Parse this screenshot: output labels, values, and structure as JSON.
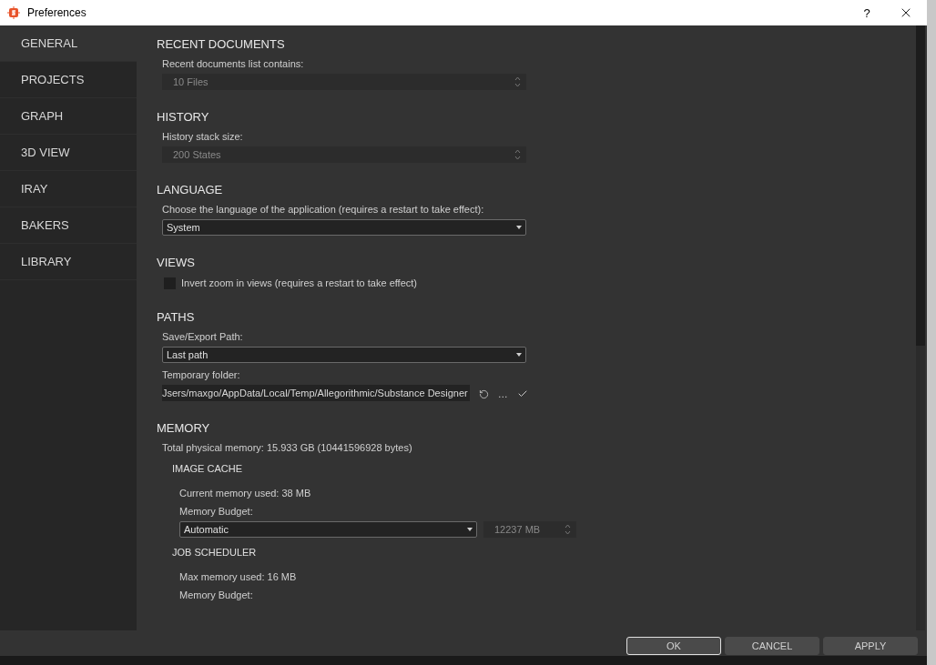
{
  "window": {
    "title": "Preferences",
    "help": "?"
  },
  "sidebar": {
    "items": [
      {
        "label": "GENERAL",
        "selected": true
      },
      {
        "label": "PROJECTS",
        "selected": false
      },
      {
        "label": "GRAPH",
        "selected": false
      },
      {
        "label": "3D VIEW",
        "selected": false
      },
      {
        "label": "IRAY",
        "selected": false
      },
      {
        "label": "BAKERS",
        "selected": false
      },
      {
        "label": "LIBRARY",
        "selected": false
      }
    ]
  },
  "sections": [
    {
      "title": "RECENT DOCUMENTS",
      "rows": [
        {
          "kind": "label",
          "text": "Recent documents list contains:"
        },
        {
          "kind": "spin",
          "value": "10 Files",
          "disabled": true
        }
      ]
    },
    {
      "title": "HISTORY",
      "rows": [
        {
          "kind": "label",
          "text": "History stack size:"
        },
        {
          "kind": "spin",
          "value": "200 States",
          "disabled": true
        }
      ]
    },
    {
      "title": "LANGUAGE",
      "rows": [
        {
          "kind": "label",
          "text": "Choose the language of the application (requires a restart to take effect):"
        },
        {
          "kind": "select",
          "value": "System"
        }
      ]
    },
    {
      "title": "VIEWS",
      "rows": [
        {
          "kind": "checkbox",
          "text": "Invert zoom in views (requires a restart to take effect)",
          "checked": false
        }
      ]
    },
    {
      "title": "PATHS",
      "rows": [
        {
          "kind": "label",
          "text": "Save/Export Path:"
        },
        {
          "kind": "select",
          "value": "Last path"
        },
        {
          "kind": "label",
          "text": "Temporary folder:"
        },
        {
          "kind": "path",
          "value": "Jsers/maxgo/AppData/Local/Temp/Allegorithmic/Substance Designer",
          "browse": "…"
        }
      ]
    },
    {
      "title": "MEMORY",
      "rows": [
        {
          "kind": "label",
          "text": "Total physical memory:  15.933 GB (10441596928 bytes)"
        },
        {
          "kind": "subsection",
          "title": "IMAGE CACHE",
          "rows": [
            {
              "kind": "label",
              "text": "Current memory used:  38 MB"
            },
            {
              "kind": "label",
              "text": "Memory Budget:"
            },
            {
              "kind": "select_spin",
              "value": "Automatic",
              "spin": "12237 MB",
              "disabled": true
            }
          ]
        },
        {
          "kind": "subsection",
          "title": "JOB SCHEDULER",
          "rows": [
            {
              "kind": "label",
              "text": "Max memory used:  16 MB"
            },
            {
              "kind": "label",
              "text": "Memory Budget:"
            }
          ]
        }
      ]
    }
  ],
  "buttons": [
    {
      "label": "OK",
      "default": true
    },
    {
      "label": "CANCEL",
      "default": false
    },
    {
      "label": "APPLY",
      "default": false
    }
  ]
}
